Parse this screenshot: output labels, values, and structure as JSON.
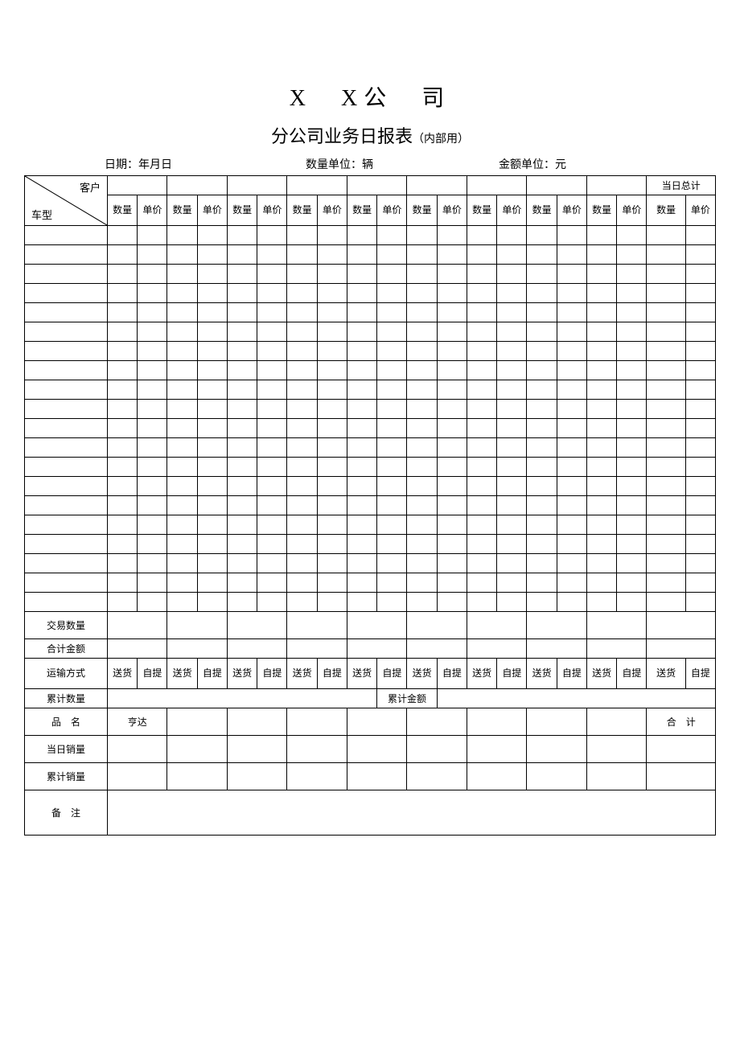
{
  "header": {
    "company": "X　X公　司",
    "report_title": "分公司业务日报表",
    "report_note": "（内部用）",
    "date_label": "日期：年月日",
    "qty_unit_label": "数量单位：辆",
    "amt_unit_label": "金额单位：元"
  },
  "corner": {
    "top": "客户",
    "bottom": "车型"
  },
  "col_pair": {
    "qty": "数量",
    "price": "单价"
  },
  "day_total_header": "当日总计",
  "summary": {
    "trade_qty": "交易数量",
    "total_amount": "合计金额",
    "shipping_method": "运输方式",
    "ship_deliver": "送货",
    "ship_pickup": "自提",
    "cum_qty": "累计数量",
    "cum_amt": "累计金额",
    "product_name": "品　名",
    "product_first": "亨达",
    "total_label": "合　计",
    "day_sales": "当日销量",
    "cum_sales": "累计销量",
    "remarks": "备　注"
  },
  "structure": {
    "customer_groups": 9,
    "blank_data_rows": 20
  }
}
